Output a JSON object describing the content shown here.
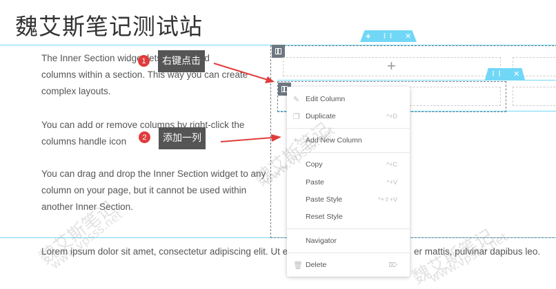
{
  "site": {
    "title": "魏艾斯笔记测试站"
  },
  "paragraphs": [
    {
      "lines": [
        "The Inner Section widget lets you nested",
        "columns within a section. This way you can create",
        "complex layouts."
      ]
    },
    {
      "lines": [
        "You can add or remove columns by right-click the",
        "columns handle icon"
      ]
    },
    {
      "lines": [
        "You can drag and drop the Inner Section widget to any",
        "column on your page, but it cannot be used within",
        "another Inner Section."
      ]
    }
  ],
  "bottom_text": "Lorem ipsum dolor sit amet, consectetur adipiscing elit. Ut el",
  "bottom_text_right": "er mattis, pulvinar dapibus leo.",
  "editor": {
    "section_tab": {
      "add": "+",
      "drag": "⋮⋮",
      "close": "✕"
    },
    "inner_tab": {
      "drag": "⋮⋮",
      "close": "✕"
    },
    "plus_glyph": "+"
  },
  "annotations": [
    {
      "number": "1",
      "label": "右键点击"
    },
    {
      "number": "2",
      "label": "添加一列"
    }
  ],
  "context_menu": {
    "items": [
      {
        "label": "Edit Column",
        "shortcut": "",
        "icon": "pencil-icon"
      },
      {
        "label": "Duplicate",
        "shortcut": "^+D",
        "icon": "copy-icon"
      },
      {
        "label": "Add New Column",
        "shortcut": "",
        "icon": "plus-icon"
      },
      {
        "label": "Copy",
        "shortcut": "^+C",
        "icon": ""
      },
      {
        "label": "Paste",
        "shortcut": "^+V",
        "icon": ""
      },
      {
        "label": "Paste Style",
        "shortcut": "^+⇧+V",
        "icon": ""
      },
      {
        "label": "Reset Style",
        "shortcut": "",
        "icon": ""
      },
      {
        "label": "Navigator",
        "shortcut": "",
        "icon": ""
      },
      {
        "label": "Delete",
        "shortcut": "⌦",
        "icon": "trash-icon"
      }
    ]
  },
  "watermark": {
    "text_cn": "魏艾斯笔记",
    "text_url": "www.vpsss.net"
  },
  "colors": {
    "accent": "#71d7f7",
    "handle": "#6d7882",
    "annotation_red": "#e03c3c",
    "annotation_label_bg": "#555555"
  }
}
